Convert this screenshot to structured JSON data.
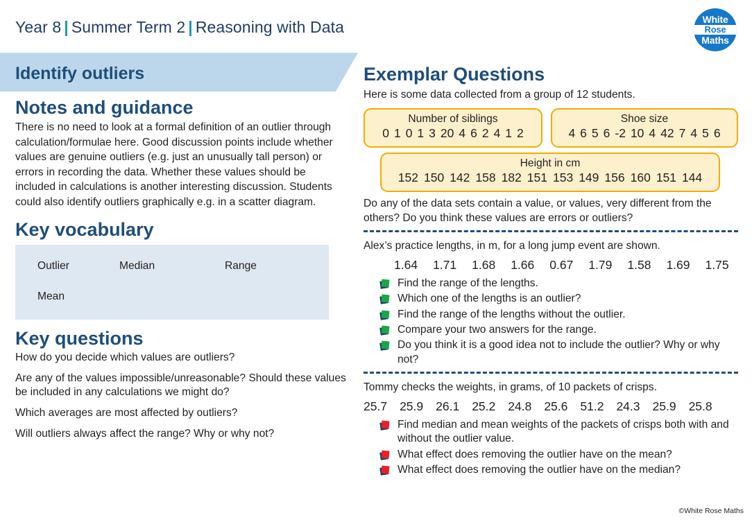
{
  "header": {
    "part1": "Year 8",
    "sep": "|",
    "part2": "Summer Term 2",
    "part3": "Reasoning with Data"
  },
  "logo": {
    "line1": "White",
    "line2": "Rose",
    "line3": "Maths"
  },
  "banner": {
    "title": "Identify outliers"
  },
  "notes": {
    "heading": "Notes and guidance",
    "body": "There is no need to look at a formal definition of an outlier through calculation/formulae here. Good discussion points include whether values are genuine outliers (e.g. just an unusually tall person) or errors in recording the data. Whether these values should be included in calculations is another interesting discussion. Students could also identify outliers graphically e.g. in a scatter diagram."
  },
  "vocabulary": {
    "heading": "Key vocabulary",
    "row1": {
      "c1": "Outlier",
      "c2": "Median",
      "c3": "Range"
    },
    "row2": {
      "c1": "Mean",
      "c2": "",
      "c3": ""
    }
  },
  "key_questions": {
    "heading": "Key questions",
    "items": [
      "How do you decide which values are outliers?",
      "Are any of the values impossible/unreasonable? Should these values be included in any calculations we might do?",
      "Which averages are most affected by outliers?",
      "Will outliers always affect the range? Why or why not?"
    ]
  },
  "exemplar": {
    "heading": "Exemplar Questions",
    "intro": "Here is some data collected from a group of 12 students.",
    "siblings": {
      "title": "Number of siblings",
      "values": [
        "0",
        "1",
        "0",
        "1",
        "3",
        "20",
        "4",
        "6",
        "2",
        "4",
        "1",
        "2"
      ]
    },
    "shoe": {
      "title": "Shoe size",
      "values": [
        "4",
        "6",
        "5",
        "6",
        "-2",
        "10",
        "4",
        "42",
        "7",
        "4",
        "5",
        "6"
      ]
    },
    "height": {
      "title": "Height in cm",
      "values": [
        "152",
        "150",
        "142",
        "158",
        "182",
        "151",
        "153",
        "149",
        "156",
        "160",
        "151",
        "144"
      ]
    },
    "q1_prompt": "Do any of the data sets contain a value, or values, very different from the others? Do you think these values are errors or outliers?",
    "alex": {
      "prompt": "Alex’s practice lengths, in m, for a long jump event are shown.",
      "values": [
        "1.64",
        "1.71",
        "1.68",
        "1.66",
        "0.67",
        "1.79",
        "1.58",
        "1.69",
        "1.75"
      ],
      "bullets": [
        "Find the range of the lengths.",
        "Which one of the lengths is an outlier?",
        "Find the range of the lengths without the outlier.",
        "Compare your two answers for the range.",
        "Do you think it is a good idea not to include the outlier? Why or why not?"
      ]
    },
    "tommy": {
      "prompt": "Tommy checks the weights, in grams, of 10 packets of crisps.",
      "values": [
        "25.7",
        "25.9",
        "26.1",
        "25.2",
        "24.8",
        "25.6",
        "51.2",
        "24.3",
        "25.9",
        "25.8"
      ],
      "bullets": [
        "Find median and mean weights of the packets of crisps both with and without the outlier value.",
        "What effect does removing the outlier have on the mean?",
        "What effect does removing the outlier have on the median?"
      ]
    }
  },
  "footer": {
    "copyright": "©White Rose Maths"
  },
  "colors": {
    "navy": "#1f4e79",
    "teal": "#1a9aa8",
    "banner_blue": "#bcd7ec",
    "vocab_blue": "#dde8f3",
    "box_fill": "#fdf0cc",
    "box_border": "#f5ab00",
    "bullet_green": "#1aa64b",
    "bullet_red": "#e8202a",
    "logo_blue": "#1878c8"
  }
}
